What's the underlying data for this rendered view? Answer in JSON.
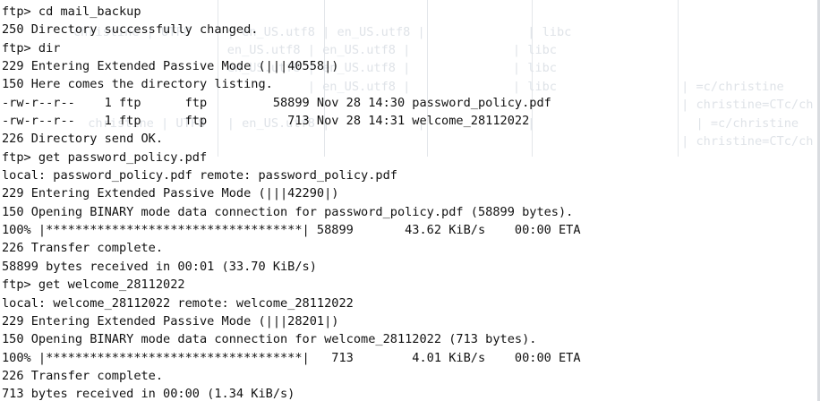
{
  "terminal": {
    "lines": [
      {
        "kind": "prompt",
        "text": "ftp> cd mail_backup"
      },
      {
        "kind": "output",
        "text": "250 Directory successfully changed."
      },
      {
        "kind": "prompt",
        "text": "ftp> dir"
      },
      {
        "kind": "output",
        "text": "229 Entering Extended Passive Mode (|||40558|)"
      },
      {
        "kind": "output",
        "text": "150 Here comes the directory listing."
      },
      {
        "kind": "listing",
        "text": "-rw-r--r--    1 ftp      ftp         58899 Nov 28 14:30 password_policy.pdf"
      },
      {
        "kind": "listing",
        "text": "-rw-r--r--    1 ftp      ftp           713 Nov 28 14:31 welcome_28112022"
      },
      {
        "kind": "output",
        "text": "226 Directory send OK."
      },
      {
        "kind": "prompt",
        "text": "ftp> get password_policy.pdf"
      },
      {
        "kind": "output",
        "text": "local: password_policy.pdf remote: password_policy.pdf"
      },
      {
        "kind": "output",
        "text": "229 Entering Extended Passive Mode (|||42290|)"
      },
      {
        "kind": "output",
        "text": "150 Opening BINARY mode data connection for password_policy.pdf (58899 bytes)."
      },
      {
        "kind": "progress",
        "text": "100% |***********************************| 58899       43.62 KiB/s    00:00 ETA"
      },
      {
        "kind": "output",
        "text": "226 Transfer complete."
      },
      {
        "kind": "output",
        "text": "58899 bytes received in 00:01 (33.70 KiB/s)"
      },
      {
        "kind": "prompt",
        "text": "ftp> get welcome_28112022"
      },
      {
        "kind": "output",
        "text": "local: welcome_28112022 remote: welcome_28112022"
      },
      {
        "kind": "output",
        "text": "229 Entering Extended Passive Mode (|||28201|)"
      },
      {
        "kind": "output",
        "text": "150 Opening BINARY mode data connection for welcome_28112022 (713 bytes)."
      },
      {
        "kind": "progress",
        "text": "100% |***********************************|   713        4.01 KiB/s    00:00 ETA"
      },
      {
        "kind": "output",
        "text": "226 Transfer complete."
      },
      {
        "kind": "output",
        "text": "713 bytes received in 00:00 (1.34 KiB/s)"
      }
    ]
  },
  "background_ghost": {
    "rows": [
      "          christine | UTF8     | en_US.utf8 | en_US.utf8 |              | libc",
      "                               en_US.utf8 | en_US.utf8 |              | libc",
      "                               en_US.utf8 | en_US.utf8 |              | libc",
      "                                          | en_US.utf8 |              | libc                 | =c/christine",
      "                                                                                             | christine=CTc/ch",
      "            christine | UTF8   | en_US.utf8 |            |              |                      | =c/christine",
      "                                                                                             | christine=CTc/ch"
    ]
  },
  "colors": {
    "background": "#ffffff",
    "foreground": "#111111",
    "ghost_text": "#dfe3e8"
  }
}
